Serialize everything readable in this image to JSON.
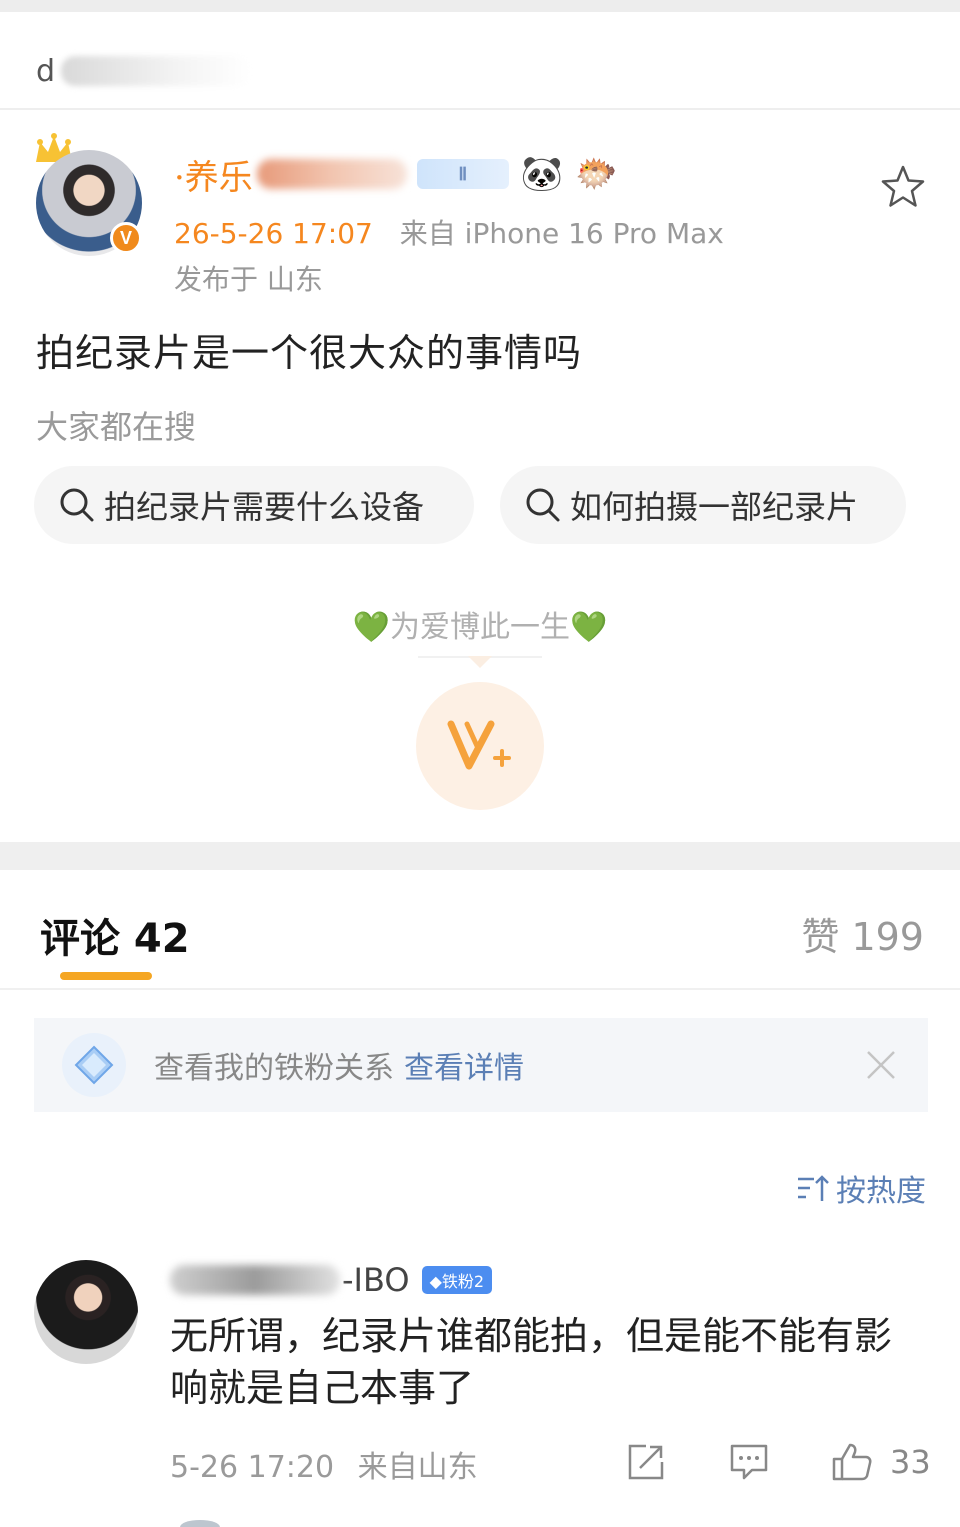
{
  "top": {
    "title_visible_fragment": "d"
  },
  "post": {
    "username_visible": "·养乐",
    "level_tag": "Ⅱ",
    "emojis": [
      "🐼",
      "🐡"
    ],
    "time": "26-5-26 17:07",
    "source": "来自 iPhone 16 Pro Max",
    "location": "发布于 山东",
    "text": "拍纪录片是一个很大众的事情吗",
    "verified_badge": "V",
    "everyone_searching_label": "大家都在搜",
    "search_chips": [
      "拍纪录片需要什么设备",
      "如何拍摄一部纪录片"
    ],
    "slogan": "💚为爱博此一生💚",
    "colors": {
      "accent": "#f5871f",
      "chip_bg": "#f5f5f5"
    }
  },
  "tabs": {
    "comments_label": "评论 42",
    "likes_label": "赞 199"
  },
  "fan_banner": {
    "text": "查看我的铁粉关系",
    "link": "查看详情"
  },
  "sort": {
    "label": "按热度"
  },
  "comment": {
    "username_visible": "-IBO",
    "fan_badge": "◆铁粉2",
    "text": "无所谓，纪录片谁都能拍，但是能不能有影响就是自己本事了",
    "time": "5-26 17:20",
    "source": "来自山东",
    "like_count": "33"
  },
  "icons": [
    "crown-icon",
    "star-icon",
    "search-icon",
    "v-plus-icon",
    "diamond-icon",
    "close-icon",
    "sort-icon",
    "share-icon",
    "reply-icon",
    "thumb-up-icon"
  ]
}
